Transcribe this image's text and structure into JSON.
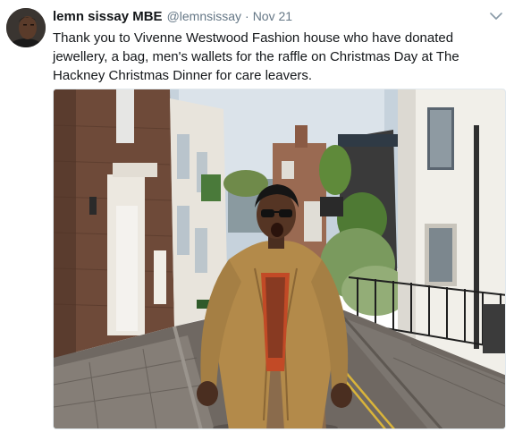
{
  "tweet": {
    "display_name": "lemn sissay MBE",
    "handle": "@lemnsissay",
    "separator": "·",
    "timestamp": "Nov 21",
    "text": "Thank you to Vivenne Westwood Fashion house who have donated jewellery, a bag, men's wallets for the raffle on Christmas Day at The Hackney Christmas Dinner for care leavers."
  },
  "icons": {
    "more": "chevron-down-icon"
  },
  "colors": {
    "text_primary": "#14171a",
    "text_secondary": "#657786",
    "border": "#e1e8ed"
  }
}
